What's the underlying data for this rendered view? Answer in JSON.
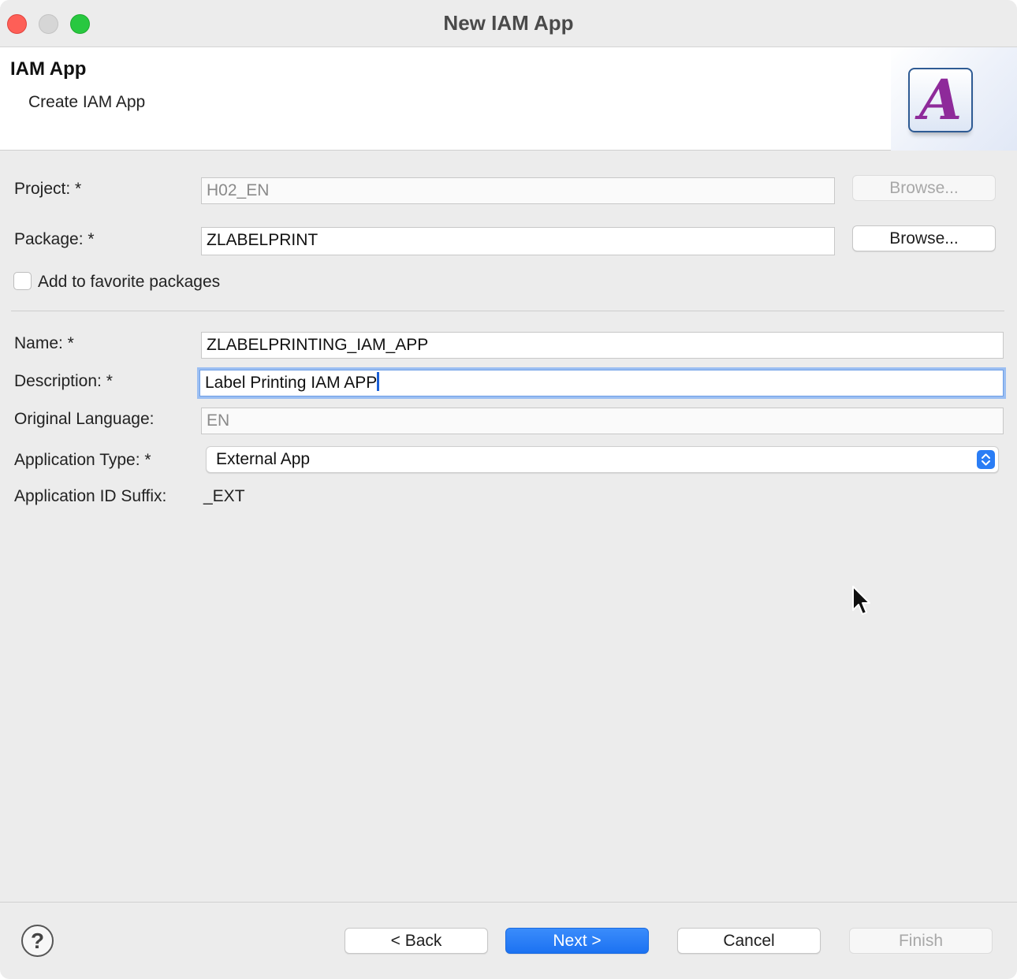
{
  "window": {
    "title": "New IAM App"
  },
  "banner": {
    "title": "IAM App",
    "subtitle": "Create IAM App",
    "logo_letter": "A"
  },
  "form": {
    "project": {
      "label": "Project: *",
      "value": "H02_EN",
      "browse_label": "Browse..."
    },
    "package": {
      "label": "Package: *",
      "value": "ZLABELPRINT",
      "browse_label": "Browse..."
    },
    "favorite": {
      "label": "Add to favorite packages",
      "checked": false
    },
    "name": {
      "label": "Name: *",
      "value": "ZLABELPRINTING_IAM_APP"
    },
    "description": {
      "label": "Description: *",
      "value": "Label Printing IAM APP"
    },
    "original_language": {
      "label": "Original Language:",
      "value": "EN"
    },
    "application_type": {
      "label": "Application Type: *",
      "value": "External App"
    },
    "application_id_suffix": {
      "label": "Application ID Suffix:",
      "value": "_EXT"
    }
  },
  "footer": {
    "help_glyph": "?",
    "back_label": "< Back",
    "next_label": "Next >",
    "cancel_label": "Cancel",
    "finish_label": "Finish"
  },
  "colors": {
    "primary_button": "#1c72f2",
    "focus_ring": "#9cbff2",
    "close": "#fe5f57",
    "maximize": "#28c840",
    "logo_letter": "#8e2a9a"
  }
}
